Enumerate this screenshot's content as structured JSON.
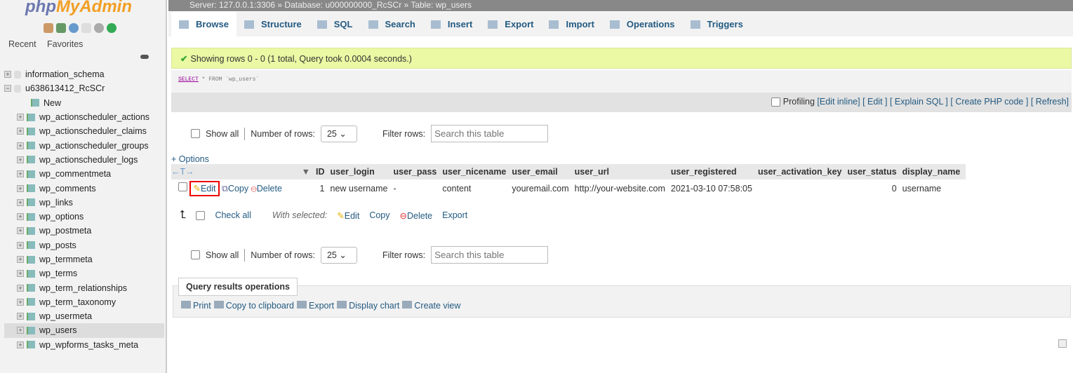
{
  "logo": {
    "php": "php",
    "myadmin": "MyAdmin"
  },
  "sidebar": {
    "recent": "Recent",
    "favorites": "Favorites",
    "databases": [
      "information_schema",
      "u638613412_RcSCr"
    ],
    "new_label": "New",
    "tables": [
      "wp_actionscheduler_actions",
      "wp_actionscheduler_claims",
      "wp_actionscheduler_groups",
      "wp_actionscheduler_logs",
      "wp_commentmeta",
      "wp_comments",
      "wp_links",
      "wp_options",
      "wp_postmeta",
      "wp_posts",
      "wp_termmeta",
      "wp_terms",
      "wp_term_relationships",
      "wp_term_taxonomy",
      "wp_usermeta",
      "wp_users",
      "wp_wpforms_tasks_meta"
    ],
    "selected": "wp_users"
  },
  "breadcrumb": "Server: 127.0.0.1:3306 » Database: u000000000_RcSCr » Table: wp_users",
  "tabs": [
    "Browse",
    "Structure",
    "SQL",
    "Search",
    "Insert",
    "Export",
    "Import",
    "Operations",
    "Triggers"
  ],
  "success": "Showing rows 0 - 0 (1 total, Query took 0.0004 seconds.)",
  "sql": {
    "select": "SELECT",
    "rest": " * FROM `wp_users`"
  },
  "profiling": {
    "label": "Profiling",
    "links": [
      "[Edit inline]",
      "[ Edit ]",
      "[ Explain SQL ]",
      "[ Create PHP code ]",
      "[ Refresh]"
    ]
  },
  "nav": {
    "show_all": "Show all",
    "rows_label": "Number of rows:",
    "rows_value": "25",
    "filter_label": "Filter rows:",
    "filter_placeholder": "Search this table"
  },
  "options": "+ Options",
  "columns": [
    "ID",
    "user_login",
    "user_pass",
    "user_nicename",
    "user_email",
    "user_url",
    "user_registered",
    "user_activation_key",
    "user_status",
    "display_name"
  ],
  "row": {
    "actions": [
      "Edit",
      "Copy",
      "Delete"
    ],
    "cells": [
      "1",
      "new username",
      "-",
      "content",
      "youremail.com",
      "http://your-website.com",
      "2021-03-10 07:58:05",
      "",
      "0",
      "username"
    ]
  },
  "bulk": {
    "check_all": "Check all",
    "with_selected": "With selected:",
    "actions": [
      "Edit",
      "Copy",
      "Delete",
      "Export"
    ]
  },
  "qro": {
    "title": "Query results operations",
    "links": [
      "Print",
      "Copy to clipboard",
      "Export",
      "Display chart",
      "Create view"
    ]
  }
}
